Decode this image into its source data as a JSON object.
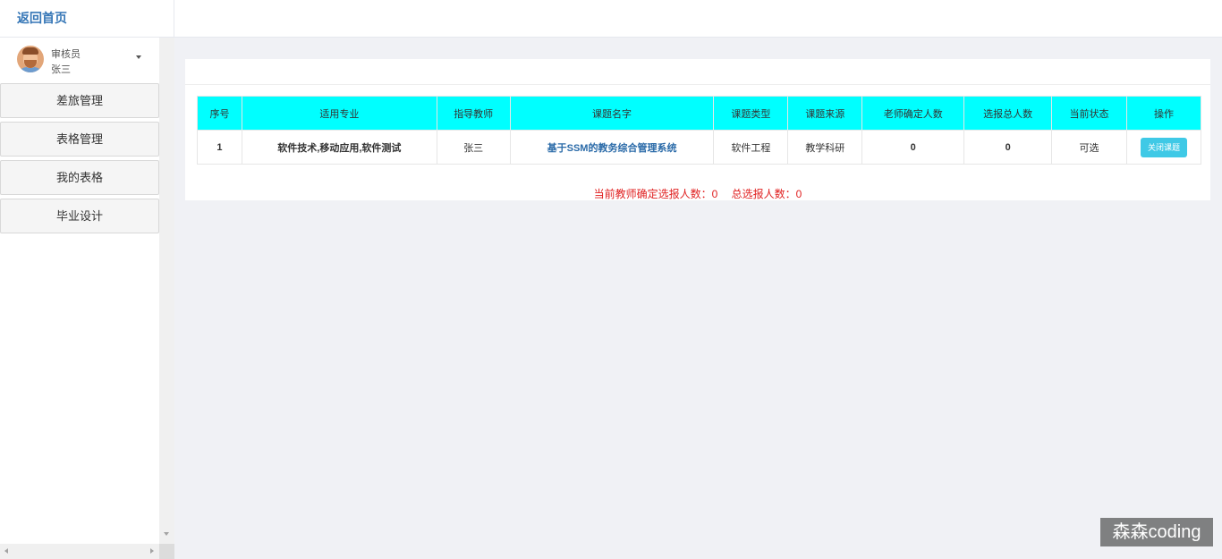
{
  "header": {
    "home_label": "返回首页"
  },
  "user": {
    "role": "审核员",
    "name": "张三"
  },
  "sidebar": {
    "items": [
      {
        "label": "差旅管理"
      },
      {
        "label": "表格管理"
      },
      {
        "label": "我的表格"
      },
      {
        "label": "毕业设计"
      }
    ]
  },
  "table": {
    "header_color": "#00ffff",
    "columns": [
      "序号",
      "适用专业",
      "指导教师",
      "课题名字",
      "课题类型",
      "课题来源",
      "老师确定人数",
      "选报总人数",
      "当前状态",
      "操作"
    ],
    "rows": [
      {
        "index": "1",
        "major": "软件技术,移动应用,软件测试",
        "teacher": "张三",
        "topic": "基于SSM的教务综合管理系统",
        "type": "软件工程",
        "source": "教学科研",
        "confirmed": "0",
        "total": "0",
        "status": "可选",
        "action": "关闭课题"
      }
    ]
  },
  "summary": {
    "confirmed_text": "当前教师确定选报人数：0",
    "total_text": "总选报人数：0"
  },
  "watermark": "森森coding"
}
